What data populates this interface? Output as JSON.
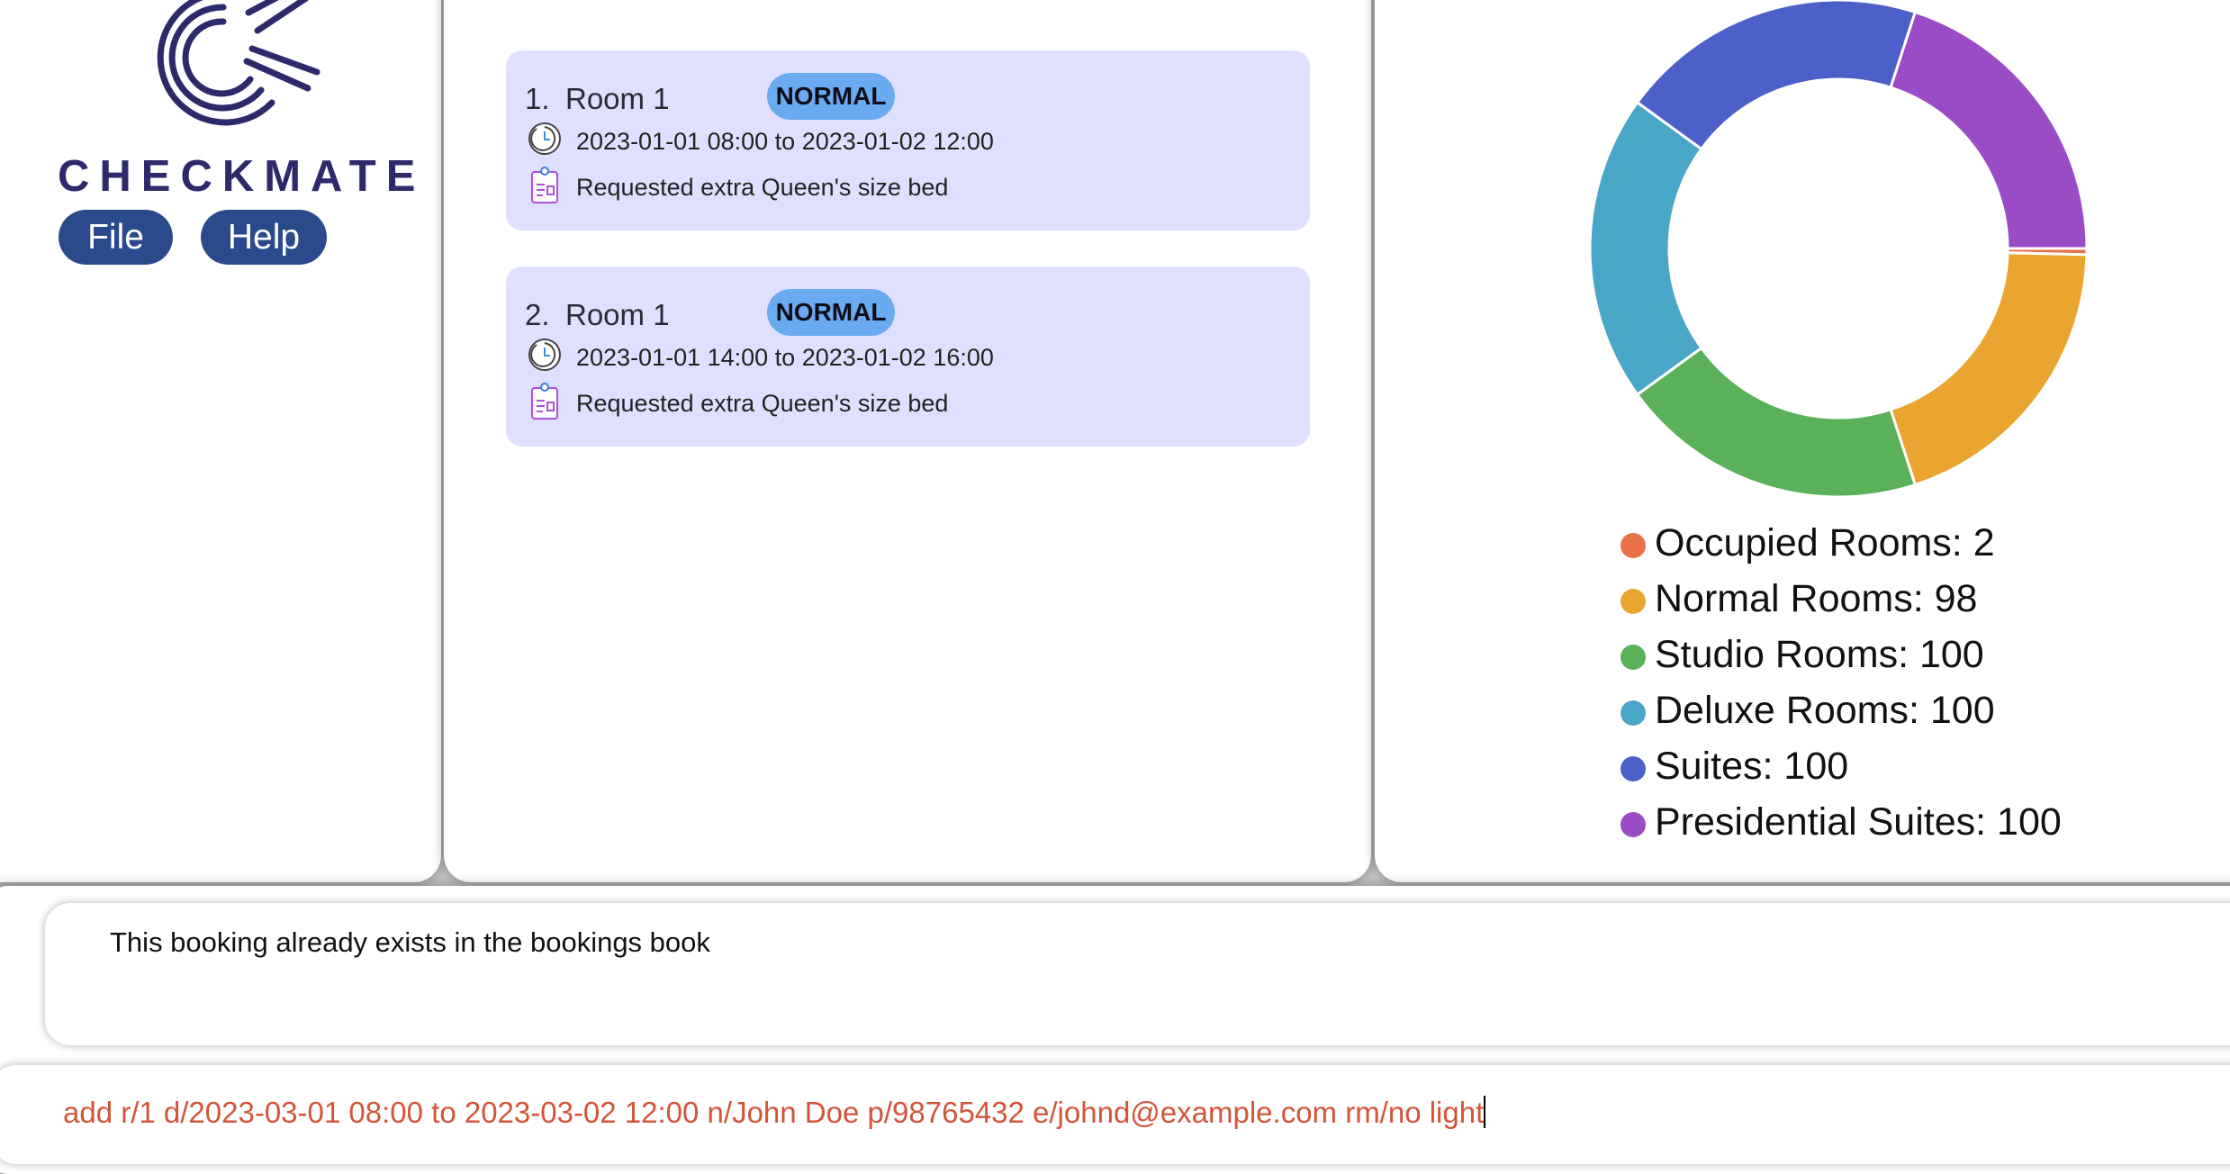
{
  "app": {
    "logo_text": "CHECKMATE",
    "menu": {
      "file_label": "File",
      "help_label": "Help"
    }
  },
  "bookings": [
    {
      "index": "1.",
      "room": "Room 1",
      "type": "NORMAL",
      "dates": "2023-01-01 08:00 to 2023-01-02 12:00",
      "note": "Requested extra Queen's size bed",
      "icon_time": "clock-icon",
      "icon_note": "clipboard-icon"
    },
    {
      "index": "2.",
      "room": "Room 1",
      "type": "NORMAL",
      "dates": "2023-01-01 14:00 to 2023-01-02 16:00",
      "note": "Requested extra Queen's size bed",
      "icon_time": "clock-icon",
      "icon_note": "clipboard-icon"
    }
  ],
  "stats": {
    "legend": [
      {
        "label": "Occupied Rooms: 2",
        "color": "#e8704a"
      },
      {
        "label": "Normal Rooms: 98",
        "color": "#eaa530"
      },
      {
        "label": "Studio Rooms: 100",
        "color": "#5bb05a"
      },
      {
        "label": "Deluxe Rooms: 100",
        "color": "#4aa6c6"
      },
      {
        "label": "Suites: 100",
        "color": "#4d5fc8"
      },
      {
        "label": "Presidential Suites: 100",
        "color": "#9a4cc6"
      }
    ]
  },
  "chart_data": {
    "type": "pie",
    "categories": [
      "Occupied Rooms",
      "Normal Rooms",
      "Studio Rooms",
      "Deluxe Rooms",
      "Suites",
      "Presidential Suites"
    ],
    "values": [
      2,
      98,
      100,
      100,
      100,
      100
    ],
    "colors": [
      "#e8704a",
      "#eaa530",
      "#5bb05a",
      "#4aa6c6",
      "#4d5fc8",
      "#9a4cc6"
    ],
    "donut": true
  },
  "result": {
    "message": "This booking already exists in the bookings book"
  },
  "command": {
    "value": "add r/1 d/2023-03-01 08:00 to 2023-03-02 12:00 n/John Doe p/98765432 e/johnd@example.com rm/no light"
  }
}
